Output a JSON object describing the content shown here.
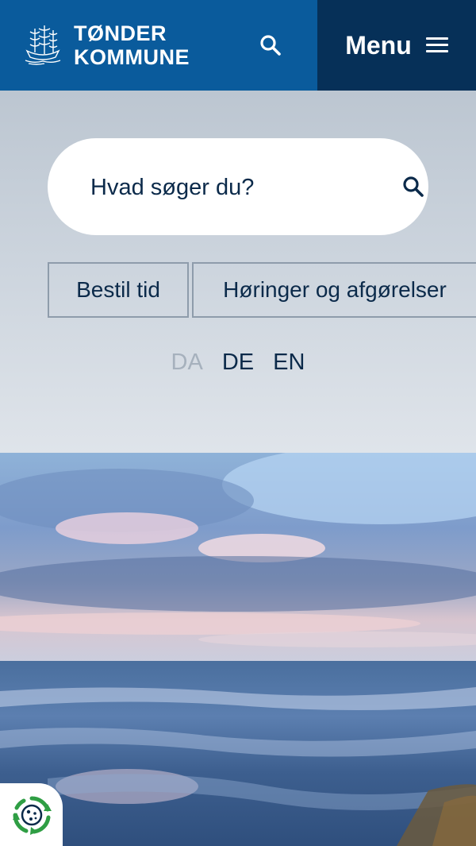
{
  "header": {
    "brand_line1": "TØNDER",
    "brand_line2": "KOMMUNE",
    "logo_icon": "ship-crest-icon",
    "search_icon": "search-icon",
    "menu_label": "Menu",
    "menu_icon": "hamburger-icon",
    "brand_color": "#0a5b9c",
    "menu_bg_color": "#063058"
  },
  "search": {
    "placeholder": "Hvad søger du?",
    "value": "",
    "button_icon": "search-icon"
  },
  "quick_links": [
    {
      "label": "Bestil tid"
    },
    {
      "label": "Høringer og afgørelser"
    }
  ],
  "languages": {
    "items": [
      {
        "code": "DA",
        "active": true
      },
      {
        "code": "DE",
        "active": false
      },
      {
        "code": "EN",
        "active": false
      }
    ]
  },
  "hero_image": {
    "subject": "coastal-seascape"
  },
  "cookie_button": {
    "icon": "cookie-settings-icon"
  }
}
